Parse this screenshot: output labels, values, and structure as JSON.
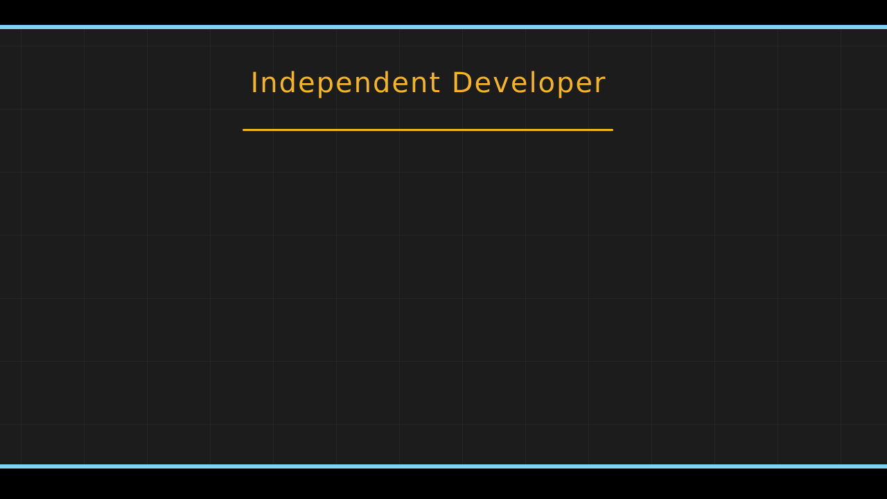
{
  "slide": {
    "title": "Independent Developer"
  },
  "colors": {
    "accent": "#7fd3f2",
    "ink": "#f5b425",
    "board": "#1c1c1c"
  }
}
